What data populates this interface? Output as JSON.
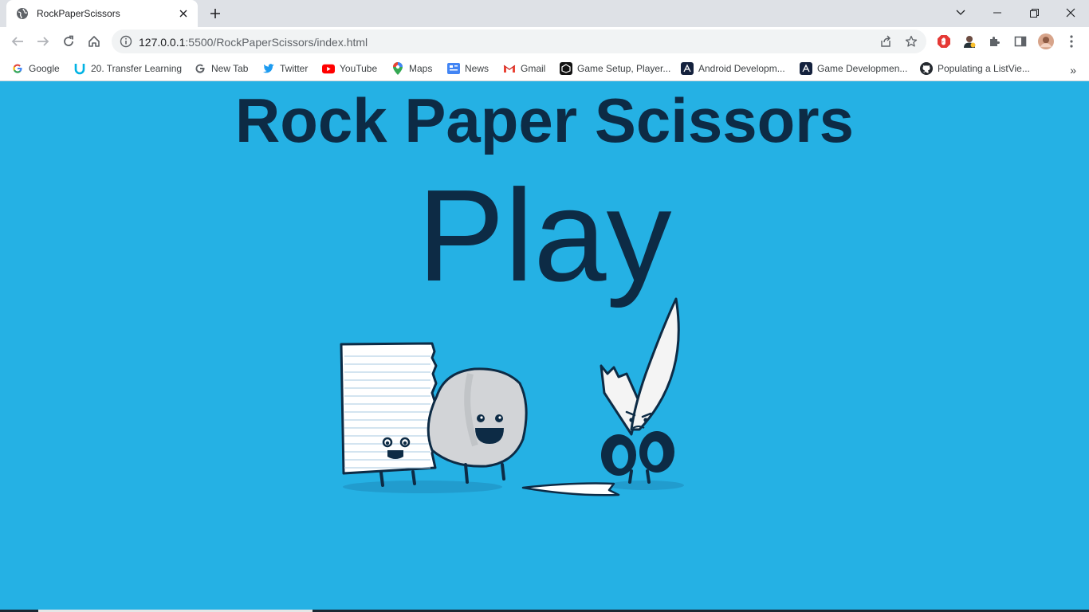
{
  "browser": {
    "tab": {
      "title": "RockPaperScissors",
      "favicon": "globe-icon"
    },
    "address": {
      "host": "127.0.0.1",
      "path": ":5500/RockPaperScissors/index.html"
    },
    "bookmarks": [
      {
        "label": "Google",
        "icon": "google-icon"
      },
      {
        "label": "20. Transfer Learning",
        "icon": "udacity-icon"
      },
      {
        "label": "New Tab",
        "icon": "google-icon"
      },
      {
        "label": "Twitter",
        "icon": "twitter-icon"
      },
      {
        "label": "YouTube",
        "icon": "youtube-icon"
      },
      {
        "label": "Maps",
        "icon": "maps-icon"
      },
      {
        "label": "News",
        "icon": "news-icon"
      },
      {
        "label": "Gmail",
        "icon": "gmail-icon"
      },
      {
        "label": "Game Setup, Player...",
        "icon": "unity-icon"
      },
      {
        "label": "Android Developm...",
        "icon": "unity-icon"
      },
      {
        "label": "Game Developmen...",
        "icon": "unity-icon"
      },
      {
        "label": "Populating a ListVie...",
        "icon": "github-icon"
      }
    ]
  },
  "page": {
    "title": "Rock Paper Scissors",
    "play_label": "Play",
    "background": "#25b1e4",
    "text_color": "#0d2b45"
  }
}
